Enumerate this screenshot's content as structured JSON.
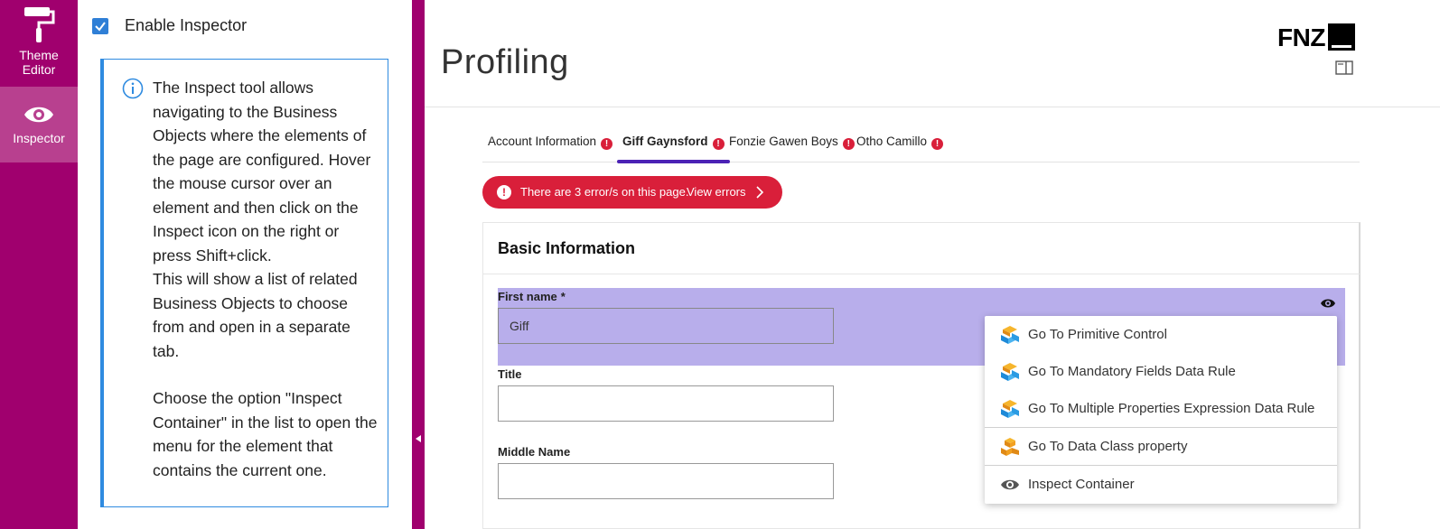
{
  "rail": {
    "items": [
      {
        "label": "Theme Editor",
        "icon": "paint-roller-icon"
      },
      {
        "label": "Inspector",
        "icon": "eye-icon"
      }
    ],
    "color": "#a0006e"
  },
  "inspector_panel": {
    "checkbox_label": "Enable Inspector",
    "checked": true,
    "info_paragraph_1": "The Inspect tool allows navigating to the Business Objects where the elements of the page are configured. Hover the mouse cursor over an element and then click on the Inspect icon on the right or press Shift+click.",
    "info_paragraph_2": "This will show a list of related Business Objects to choose from and open in a separate tab.",
    "info_paragraph_3": "Choose the option \"Inspect Container\" in the list to open the menu for the element that contains the current one."
  },
  "header": {
    "title": "Profiling",
    "logo": "FNZ"
  },
  "tabs": [
    {
      "label": "Account Information",
      "active": false,
      "error": "!"
    },
    {
      "label": "Giff Gaynsford",
      "active": true,
      "error": "!"
    },
    {
      "label": "Fonzie Gawen Boys",
      "active": false,
      "error": "!"
    },
    {
      "label": "Otho Camillo",
      "active": false,
      "error": "!"
    }
  ],
  "error_banner": {
    "message": "There are 3 error/s on this page.",
    "link": "View errors",
    "color": "#d91f3a"
  },
  "card": {
    "title": "Basic Information",
    "fields": [
      {
        "label": "First name",
        "required_mark": "*",
        "value": "Giff"
      },
      {
        "label": "Title",
        "value": ""
      },
      {
        "label": "Middle Name",
        "value": ""
      }
    ]
  },
  "context_menu": {
    "items": [
      {
        "label": "Go To Primitive Control",
        "icon": "blocks-blue-icon"
      },
      {
        "label": "Go To Mandatory Fields Data Rule",
        "icon": "blocks-blue-icon"
      },
      {
        "label": "Go To Multiple Properties Expression Data Rule",
        "icon": "blocks-blue-icon"
      },
      {
        "label": "Go To Data Class property",
        "icon": "blocks-orange-icon"
      },
      {
        "label": "Inspect Container",
        "icon": "eye-icon"
      }
    ]
  },
  "colors": {
    "highlight": "#b8aeeb",
    "active_tab": "#4b22b5",
    "info_border": "#2f8be0"
  }
}
